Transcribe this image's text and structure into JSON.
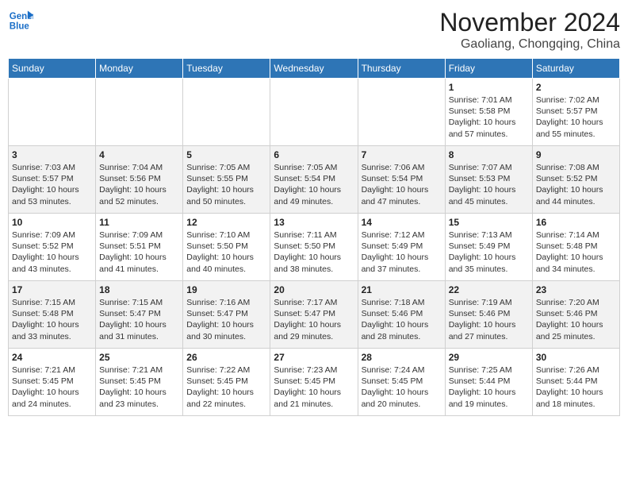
{
  "header": {
    "logo_line1": "General",
    "logo_line2": "Blue",
    "month": "November 2024",
    "location": "Gaoliang, Chongqing, China"
  },
  "days_of_week": [
    "Sunday",
    "Monday",
    "Tuesday",
    "Wednesday",
    "Thursday",
    "Friday",
    "Saturday"
  ],
  "weeks": [
    [
      {
        "num": "",
        "info": ""
      },
      {
        "num": "",
        "info": ""
      },
      {
        "num": "",
        "info": ""
      },
      {
        "num": "",
        "info": ""
      },
      {
        "num": "",
        "info": ""
      },
      {
        "num": "1",
        "info": "Sunrise: 7:01 AM\nSunset: 5:58 PM\nDaylight: 10 hours\nand 57 minutes."
      },
      {
        "num": "2",
        "info": "Sunrise: 7:02 AM\nSunset: 5:57 PM\nDaylight: 10 hours\nand 55 minutes."
      }
    ],
    [
      {
        "num": "3",
        "info": "Sunrise: 7:03 AM\nSunset: 5:57 PM\nDaylight: 10 hours\nand 53 minutes."
      },
      {
        "num": "4",
        "info": "Sunrise: 7:04 AM\nSunset: 5:56 PM\nDaylight: 10 hours\nand 52 minutes."
      },
      {
        "num": "5",
        "info": "Sunrise: 7:05 AM\nSunset: 5:55 PM\nDaylight: 10 hours\nand 50 minutes."
      },
      {
        "num": "6",
        "info": "Sunrise: 7:05 AM\nSunset: 5:54 PM\nDaylight: 10 hours\nand 49 minutes."
      },
      {
        "num": "7",
        "info": "Sunrise: 7:06 AM\nSunset: 5:54 PM\nDaylight: 10 hours\nand 47 minutes."
      },
      {
        "num": "8",
        "info": "Sunrise: 7:07 AM\nSunset: 5:53 PM\nDaylight: 10 hours\nand 45 minutes."
      },
      {
        "num": "9",
        "info": "Sunrise: 7:08 AM\nSunset: 5:52 PM\nDaylight: 10 hours\nand 44 minutes."
      }
    ],
    [
      {
        "num": "10",
        "info": "Sunrise: 7:09 AM\nSunset: 5:52 PM\nDaylight: 10 hours\nand 43 minutes."
      },
      {
        "num": "11",
        "info": "Sunrise: 7:09 AM\nSunset: 5:51 PM\nDaylight: 10 hours\nand 41 minutes."
      },
      {
        "num": "12",
        "info": "Sunrise: 7:10 AM\nSunset: 5:50 PM\nDaylight: 10 hours\nand 40 minutes."
      },
      {
        "num": "13",
        "info": "Sunrise: 7:11 AM\nSunset: 5:50 PM\nDaylight: 10 hours\nand 38 minutes."
      },
      {
        "num": "14",
        "info": "Sunrise: 7:12 AM\nSunset: 5:49 PM\nDaylight: 10 hours\nand 37 minutes."
      },
      {
        "num": "15",
        "info": "Sunrise: 7:13 AM\nSunset: 5:49 PM\nDaylight: 10 hours\nand 35 minutes."
      },
      {
        "num": "16",
        "info": "Sunrise: 7:14 AM\nSunset: 5:48 PM\nDaylight: 10 hours\nand 34 minutes."
      }
    ],
    [
      {
        "num": "17",
        "info": "Sunrise: 7:15 AM\nSunset: 5:48 PM\nDaylight: 10 hours\nand 33 minutes."
      },
      {
        "num": "18",
        "info": "Sunrise: 7:15 AM\nSunset: 5:47 PM\nDaylight: 10 hours\nand 31 minutes."
      },
      {
        "num": "19",
        "info": "Sunrise: 7:16 AM\nSunset: 5:47 PM\nDaylight: 10 hours\nand 30 minutes."
      },
      {
        "num": "20",
        "info": "Sunrise: 7:17 AM\nSunset: 5:47 PM\nDaylight: 10 hours\nand 29 minutes."
      },
      {
        "num": "21",
        "info": "Sunrise: 7:18 AM\nSunset: 5:46 PM\nDaylight: 10 hours\nand 28 minutes."
      },
      {
        "num": "22",
        "info": "Sunrise: 7:19 AM\nSunset: 5:46 PM\nDaylight: 10 hours\nand 27 minutes."
      },
      {
        "num": "23",
        "info": "Sunrise: 7:20 AM\nSunset: 5:46 PM\nDaylight: 10 hours\nand 25 minutes."
      }
    ],
    [
      {
        "num": "24",
        "info": "Sunrise: 7:21 AM\nSunset: 5:45 PM\nDaylight: 10 hours\nand 24 minutes."
      },
      {
        "num": "25",
        "info": "Sunrise: 7:21 AM\nSunset: 5:45 PM\nDaylight: 10 hours\nand 23 minutes."
      },
      {
        "num": "26",
        "info": "Sunrise: 7:22 AM\nSunset: 5:45 PM\nDaylight: 10 hours\nand 22 minutes."
      },
      {
        "num": "27",
        "info": "Sunrise: 7:23 AM\nSunset: 5:45 PM\nDaylight: 10 hours\nand 21 minutes."
      },
      {
        "num": "28",
        "info": "Sunrise: 7:24 AM\nSunset: 5:45 PM\nDaylight: 10 hours\nand 20 minutes."
      },
      {
        "num": "29",
        "info": "Sunrise: 7:25 AM\nSunset: 5:44 PM\nDaylight: 10 hours\nand 19 minutes."
      },
      {
        "num": "30",
        "info": "Sunrise: 7:26 AM\nSunset: 5:44 PM\nDaylight: 10 hours\nand 18 minutes."
      }
    ]
  ]
}
